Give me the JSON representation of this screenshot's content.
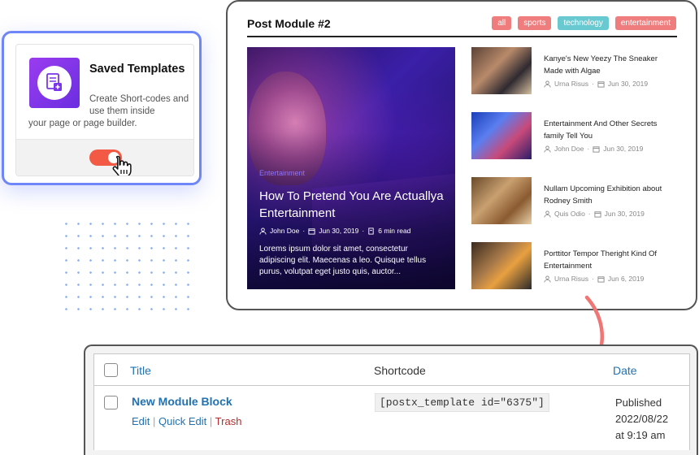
{
  "template_card": {
    "title": "Saved Templates",
    "desc_line1": "Create Short-codes and use them inside",
    "desc_line2": "your page or page builder.",
    "toggle_on": true
  },
  "post_module": {
    "title": "Post Module #2",
    "tabs": [
      "all",
      "sports",
      "technology",
      "entertainment"
    ],
    "hero": {
      "category": "Entertainment",
      "headline": "How To Pretend You Are Actuallya Entertainment",
      "author": "John Doe",
      "date": "Jun 30, 2019",
      "read_time": "6 min read",
      "excerpt": "Lorems ipsum dolor sit amet, consectetur adipiscing elit. Maecenas a leo. Quisque tellus purus, volutpat eget justo quis, auctor..."
    },
    "posts": [
      {
        "title": "Kanye's New Yeezy The Sneaker Made with Algae",
        "author": "Urna Risus",
        "date": "Jun 30, 2019"
      },
      {
        "title": "Entertainment And Other Secrets family Tell You",
        "author": "John Doe",
        "date": "Jun 30, 2019"
      },
      {
        "title": "Nullam Upcoming Exhibition about Rodney Smith",
        "author": "Quis Odio",
        "date": "Jun 30, 2019"
      },
      {
        "title": "Porttitor Tempor Theright Kind Of Entertainment",
        "author": "Urna Risus",
        "date": "Jun 6, 2019"
      }
    ]
  },
  "table": {
    "headers": {
      "title": "Title",
      "shortcode": "Shortcode",
      "date": "Date"
    },
    "row": {
      "title": "New Module Block",
      "actions": {
        "edit": "Edit",
        "quick_edit": "Quick Edit",
        "trash": "Trash"
      },
      "shortcode": "[postx_template id=\"6375\"]",
      "date_status": "Published",
      "date_value": "2022/08/22",
      "date_time": "at 9:19 am"
    }
  },
  "colors": {
    "accent_blue": "#6f86f8",
    "toggle_red": "#f35a45",
    "tab_red": "#f07d7d",
    "tab_teal": "#68c9d0",
    "wp_link": "#2271b1",
    "arrow": "#f07575"
  }
}
